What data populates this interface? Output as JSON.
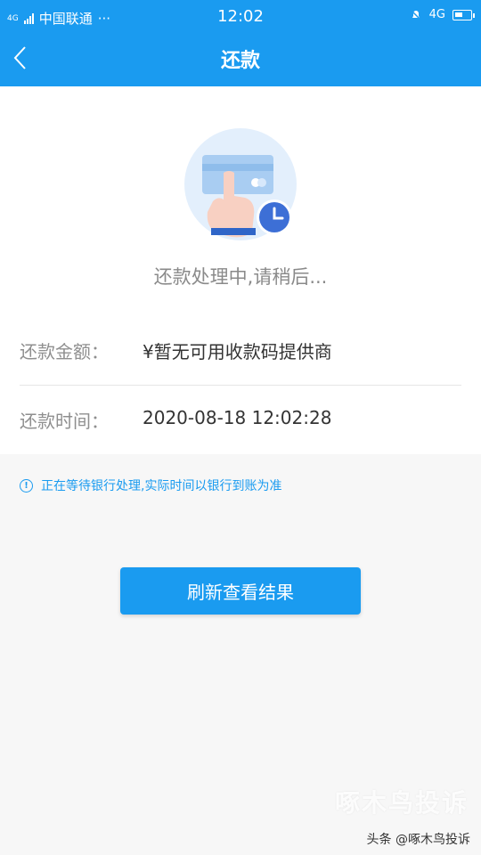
{
  "status_bar": {
    "network_left": "4G",
    "carrier": "中国联通",
    "more": "···",
    "time": "12:02",
    "network_right": "4G"
  },
  "navbar": {
    "title": "还款",
    "back_icon": "chevron-left-icon"
  },
  "main": {
    "illustration_icon": "card-tap-clock-icon",
    "status_text": "还款处理中,请稍后...",
    "rows": [
      {
        "label": "还款金额：",
        "value": "¥暂无可用收款码提供商"
      },
      {
        "label": "还款时间：",
        "value": "2020-08-18 12:02:28"
      }
    ]
  },
  "notice": {
    "icon": "info-icon",
    "text": "正在等待银行处理,实际时间以银行到账为准"
  },
  "action": {
    "refresh_label": "刷新查看结果"
  },
  "watermark": {
    "brand": "啄木鸟投诉",
    "source": "头条 @啄木鸟投诉"
  },
  "colors": {
    "accent": "#1a9bf0",
    "label_gray": "#8f8f8f",
    "value_dark": "#333333"
  }
}
